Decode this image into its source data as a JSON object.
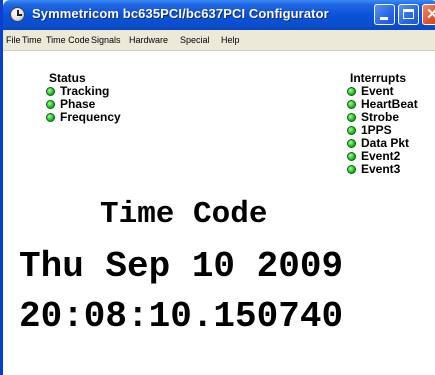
{
  "window": {
    "title": "Symmetricom bc635PCI/bc637PCI Configurator"
  },
  "menu": [
    {
      "label": "File"
    },
    {
      "label": "Time"
    },
    {
      "label": "Time Code"
    },
    {
      "label": "Signals"
    },
    {
      "label": "Hardware"
    },
    {
      "label": "Special"
    },
    {
      "label": "Help"
    }
  ],
  "status": {
    "heading": "Status",
    "items": [
      {
        "label": "Tracking",
        "indicator": "green"
      },
      {
        "label": "Phase",
        "indicator": "green"
      },
      {
        "label": "Frequency",
        "indicator": "green"
      }
    ]
  },
  "interrupts": {
    "heading": "Interrupts",
    "items": [
      {
        "label": "Event",
        "indicator": "green"
      },
      {
        "label": "HeartBeat",
        "indicator": "green"
      },
      {
        "label": "Strobe",
        "indicator": "green"
      },
      {
        "label": "1PPS",
        "indicator": "green"
      },
      {
        "label": "Data Pkt",
        "indicator": "green"
      },
      {
        "label": "Event2",
        "indicator": "green"
      },
      {
        "label": "Event3",
        "indicator": "green"
      }
    ]
  },
  "timecode": {
    "label": "Time Code",
    "date": "Thu Sep 10 2009",
    "time": "20:08:10.150740"
  },
  "colors": {
    "titlebar": "#0a53d8",
    "indicator_on": "#22c422",
    "close_button": "#e2542c"
  },
  "icons": {
    "app": "clock-icon",
    "minimize": "minimize-icon",
    "maximize": "maximize-icon",
    "close": "close-icon"
  }
}
